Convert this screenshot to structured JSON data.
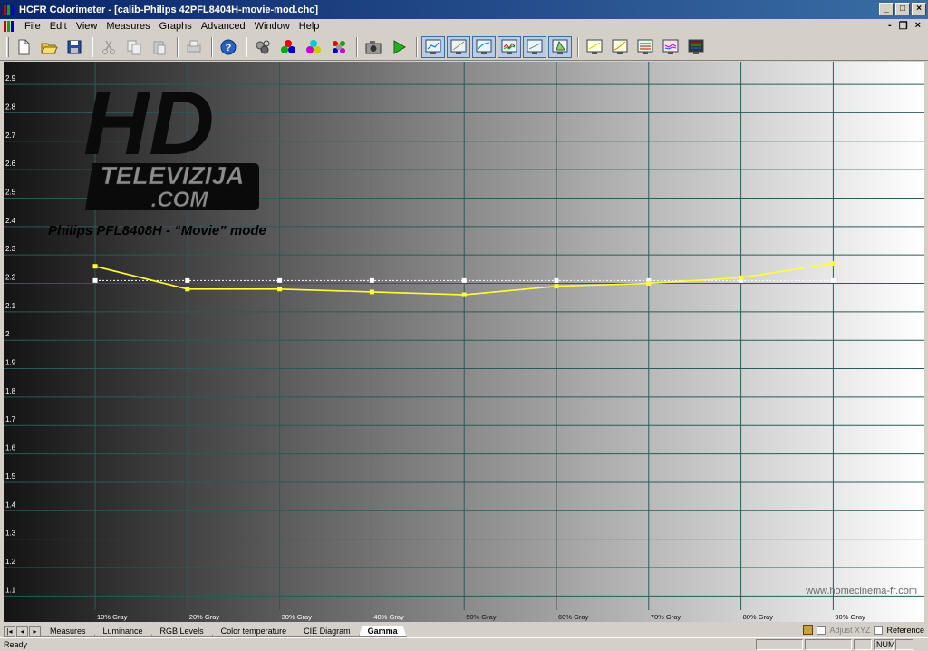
{
  "window": {
    "title": "HCFR Colorimeter - [calib-Philips 42PFL8404H-movie-mod.chc]",
    "minimize": "_",
    "maximize": "□",
    "close": "×"
  },
  "menu": {
    "items": [
      "File",
      "Edit",
      "View",
      "Measures",
      "Graphs",
      "Advanced",
      "Window",
      "Help"
    ],
    "mdi_minimize": "-",
    "mdi_restore": "❐",
    "mdi_close": "×"
  },
  "toolbar": {
    "buttons": [
      {
        "name": "new-icon"
      },
      {
        "name": "open-icon"
      },
      {
        "name": "save-icon"
      },
      {
        "name": "cut-icon"
      },
      {
        "name": "copy-icon"
      },
      {
        "name": "paste-icon"
      },
      {
        "name": "print-icon"
      },
      {
        "name": "help-icon"
      },
      {
        "name": "measure-gray-icon"
      },
      {
        "name": "measure-primaries-icon"
      },
      {
        "name": "measure-secondaries-icon"
      },
      {
        "name": "measure-all-icon"
      },
      {
        "name": "camera-icon"
      },
      {
        "name": "play-icon"
      },
      {
        "name": "graph-1-icon"
      },
      {
        "name": "graph-2-icon"
      },
      {
        "name": "graph-3-icon"
      },
      {
        "name": "graph-4-icon"
      },
      {
        "name": "graph-5-icon"
      },
      {
        "name": "graph-cie-icon"
      },
      {
        "name": "graph-6-icon"
      },
      {
        "name": "graph-7-icon"
      },
      {
        "name": "graph-8-icon"
      },
      {
        "name": "graph-9-icon"
      },
      {
        "name": "graph-10-icon"
      }
    ]
  },
  "overlay": {
    "logo_hd": "HD",
    "logo_line1": "TELEVIZIJA",
    "logo_line2": ".COM",
    "subtitle": "Philips PFL8408H - “Movie” mode",
    "site": "www.homecinema-fr.com"
  },
  "colors": {
    "measured_line": "#ffff33",
    "reference_line": "#ffffff",
    "grid": "#2a5a5a"
  },
  "chart_data": {
    "type": "line",
    "title": "",
    "xlabel": "",
    "ylabel": "",
    "x": [
      "10% Gray",
      "20% Gray",
      "30% Gray",
      "40% Gray",
      "50% Gray",
      "60% Gray",
      "70% Gray",
      "80% Gray",
      "90% Gray"
    ],
    "ylim": [
      1.05,
      2.98
    ],
    "yticks": [
      "2.9",
      "2.8",
      "2.7",
      "2.6",
      "2.5",
      "2.4",
      "2.3",
      "2.2",
      "2.1",
      "2",
      "1.9",
      "1.8",
      "1.7",
      "1.6",
      "1.5",
      "1.4",
      "1.3",
      "1.2",
      "1.1"
    ],
    "grid": true,
    "series": [
      {
        "values": [
          2.26,
          2.18,
          2.18,
          2.17,
          2.16,
          2.19,
          2.2,
          2.22,
          2.27
        ]
      },
      {
        "values": [
          2.21,
          2.21,
          2.21,
          2.21,
          2.21,
          2.21,
          2.21,
          2.21,
          2.21
        ]
      }
    ]
  },
  "tabs": {
    "nav": [
      "|◂",
      "◂",
      "▸"
    ],
    "items": [
      "Measures",
      "Luminance",
      "RGB Levels",
      "Color temperature",
      "CIE Diagram",
      "Gamma"
    ],
    "active": "Gamma",
    "adjust_xyz": "Adjust XYZ",
    "reference": "Reference"
  },
  "status": {
    "text": "Ready",
    "num": "NUM"
  }
}
